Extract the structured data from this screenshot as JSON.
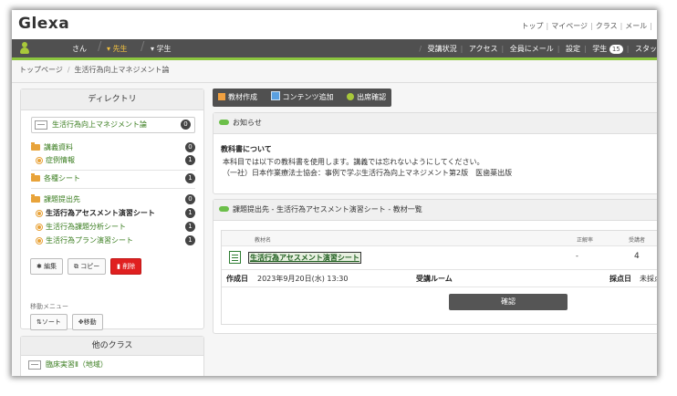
{
  "app": {
    "logo": "Glexa"
  },
  "top_links": [
    "トップ",
    "マイページ",
    "クラス",
    "メール"
  ],
  "user_bar": {
    "user_suffix": "さん",
    "roles": [
      "先生",
      "学生"
    ],
    "nav": [
      "受講状況",
      "アクセス",
      "全員にメール",
      "設定",
      "学生",
      "スタッ"
    ],
    "student_count": "15"
  },
  "breadcrumb": [
    "トップページ",
    "生活行為向上マネジメント論"
  ],
  "directory": {
    "title": "ディレクトリ",
    "root": {
      "label": "生活行為向上マネジメント論",
      "count": "0"
    },
    "items": [
      {
        "label": "講義資料",
        "count": "0"
      },
      {
        "label": "症例情報",
        "count": "1"
      },
      {
        "label": "各種シート",
        "count": "1"
      },
      {
        "label": "課題提出先",
        "count": "0"
      },
      {
        "label": "生活行為アセスメント演習シート",
        "count": "1"
      },
      {
        "label": "生活行為課題分析シート",
        "count": "1"
      },
      {
        "label": "生活行為プラン演習シート",
        "count": "1"
      }
    ],
    "buttons": {
      "edit": "編集",
      "copy": "コピー",
      "delete": "削除"
    },
    "move_menu_label": "移動メニュー",
    "move_buttons": {
      "sort": "ソート",
      "move": "移動"
    }
  },
  "other_classes": {
    "title": "他のクラス",
    "items": [
      "臨床実習Ⅱ（地域）"
    ]
  },
  "toolbar": {
    "create": "教材作成",
    "add_content": "コンテンツ追加",
    "attendance": "出席確認"
  },
  "notice": {
    "header": "お知らせ",
    "title": "教科書について",
    "line1": "本科目では以下の教科書を使用します。講義では忘れないようにしてください。",
    "line2": "（一社）日本作業療法士協会：事例で学ぶ生活行為向上マネジメント第2版　医歯薬出版"
  },
  "submission": {
    "header": "課題提出先 - 生活行為アセスメント演習シート - 教材一覧",
    "columns": [
      "教材名",
      "正解率",
      "受講者"
    ],
    "material": {
      "name": "生活行為アセスメント演習シート",
      "accuracy": "-",
      "learners": "4"
    },
    "created_label": "作成日",
    "created_value": "2023年9月20日(水) 13:30",
    "room_label": "受講ルーム",
    "grade_label": "採点日",
    "grade_value": "未採点",
    "confirm": "確認"
  },
  "colors": {
    "accent_green": "#8cc63f",
    "bar_dark": "#505050",
    "delete_red": "#e02020",
    "link_green": "#3a7d1f"
  }
}
